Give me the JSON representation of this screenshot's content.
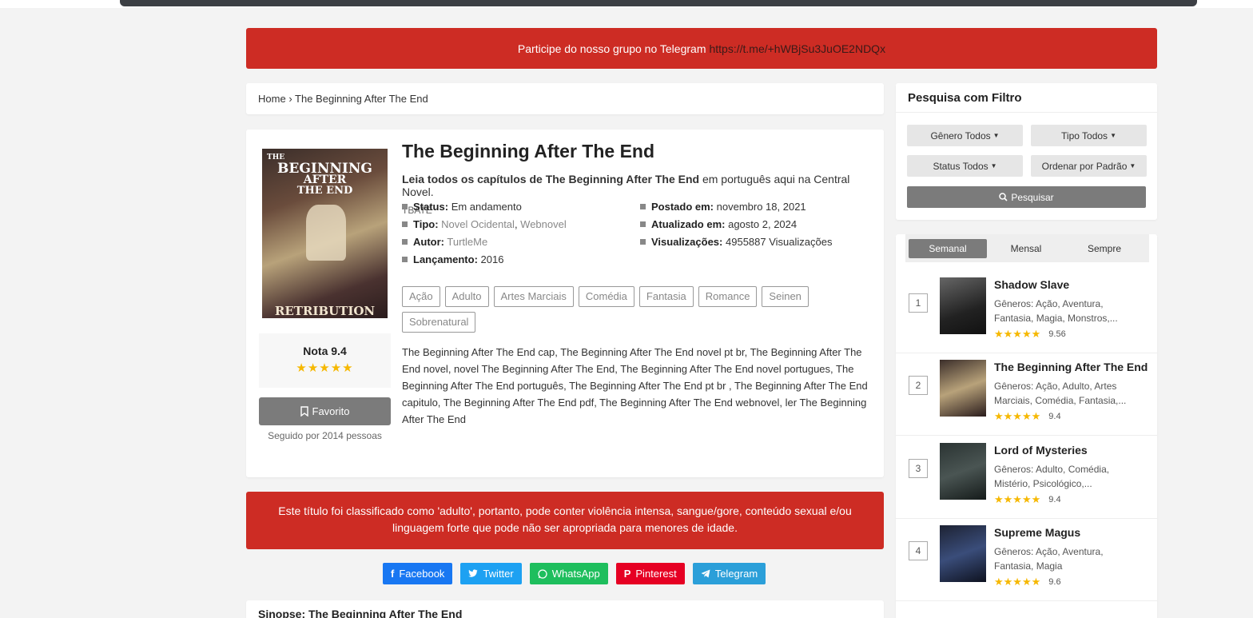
{
  "banner": {
    "text": "Participe do nosso grupo no Telegram",
    "link": "https://t.me/+hWBjSu3JuOE2NDQx"
  },
  "breadcrumb": {
    "home": "Home",
    "sep": "›",
    "current": "The Beginning After The End"
  },
  "novel": {
    "cover_title_line1": "THE",
    "cover_title_line2": "BEGINNING",
    "cover_title_line3": "AFTER",
    "cover_title_line4": "THE END",
    "cover_subtitle": "RETRIBUTION",
    "title": "The Beginning After The End",
    "desc_bold": "Leia todos os capítulos de The Beginning After The End",
    "desc_rest": " em português aqui na Central Novel.",
    "alt_title": "TBATE",
    "status_label": "Status:",
    "status": "Em andamento",
    "tipo_label": "Tipo:",
    "tipo1": "Novel Ocidental",
    "tipo2": "Webnovel",
    "autor_label": "Autor:",
    "autor": "TurtleMe",
    "lancamento_label": "Lançamento:",
    "lancamento": "2016",
    "postado_label": "Postado em:",
    "postado": "novembro 18, 2021",
    "atualizado_label": "Atualizado em:",
    "atualizado": "agosto 2, 2024",
    "views_label": "Visualizações:",
    "views": "4955887 Visualizações",
    "rating": "Nota 9.4",
    "stars": "★★★★★",
    "favorite": "Favorito",
    "followers": "Seguido por 2014 pessoas",
    "tags": [
      "Ação",
      "Adulto",
      "Artes Marciais",
      "Comédia",
      "Fantasia",
      "Romance",
      "Seinen",
      "Sobrenatural"
    ],
    "synopsis_text": "The Beginning After The End cap, The Beginning After The End novel pt br, The Beginning After The End novel, novel The Beginning After The End, The Beginning After The End novel portugues, The Beginning After The End português, The Beginning After The End pt br , The Beginning After The End capitulo, The Beginning After The End pdf, The Beginning After The End webnovel, ler The Beginning After The End"
  },
  "warning": {
    "line1": "Este título foi classificado como 'adulto', portanto, pode conter violência intensa, sangue/gore, conteúdo sexual e/ou",
    "line2": "linguagem forte que pode não ser apropriada para menores de idade."
  },
  "share": {
    "facebook": "Facebook",
    "twitter": "Twitter",
    "whatsapp": "WhatsApp",
    "pinterest": "Pinterest",
    "telegram": "Telegram",
    "colors": {
      "facebook": "#1877f2",
      "twitter": "#1da1f2",
      "whatsapp": "#1ebe5d",
      "pinterest": "#e60023",
      "telegram": "#2b9fd9"
    }
  },
  "sinopse_heading": "Sinopse: The Beginning After The End",
  "filter": {
    "title": "Pesquisa com Filtro",
    "genre": "Gênero Todos",
    "type": "Tipo Todos",
    "status": "Status Todos",
    "order": "Ordenar por Padrão",
    "search": "Pesquisar"
  },
  "popular": {
    "tabs": [
      "Semanal",
      "Mensal",
      "Sempre"
    ],
    "items": [
      {
        "rank": "1",
        "title": "Shadow Slave",
        "genres": "Gêneros: Ação, Aventura, Fantasia, Magia, Monstros,...",
        "stars": "★★★★★",
        "score": "9.56"
      },
      {
        "rank": "2",
        "title": "The Beginning After The End",
        "genres": "Gêneros: Ação, Adulto, Artes Marciais, Comédia, Fantasia,...",
        "stars": "★★★★★",
        "score": "9.4"
      },
      {
        "rank": "3",
        "title": "Lord of Mysteries",
        "genres": "Gêneros: Adulto, Comédia, Mistério, Psicológico,...",
        "stars": "★★★★★",
        "score": "9.4"
      },
      {
        "rank": "4",
        "title": "Supreme Magus",
        "genres": "Gêneros: Ação, Aventura, Fantasia, Magia",
        "stars": "★★★★★",
        "score": "9.6"
      }
    ]
  },
  "accent_red": "#cd2c24"
}
